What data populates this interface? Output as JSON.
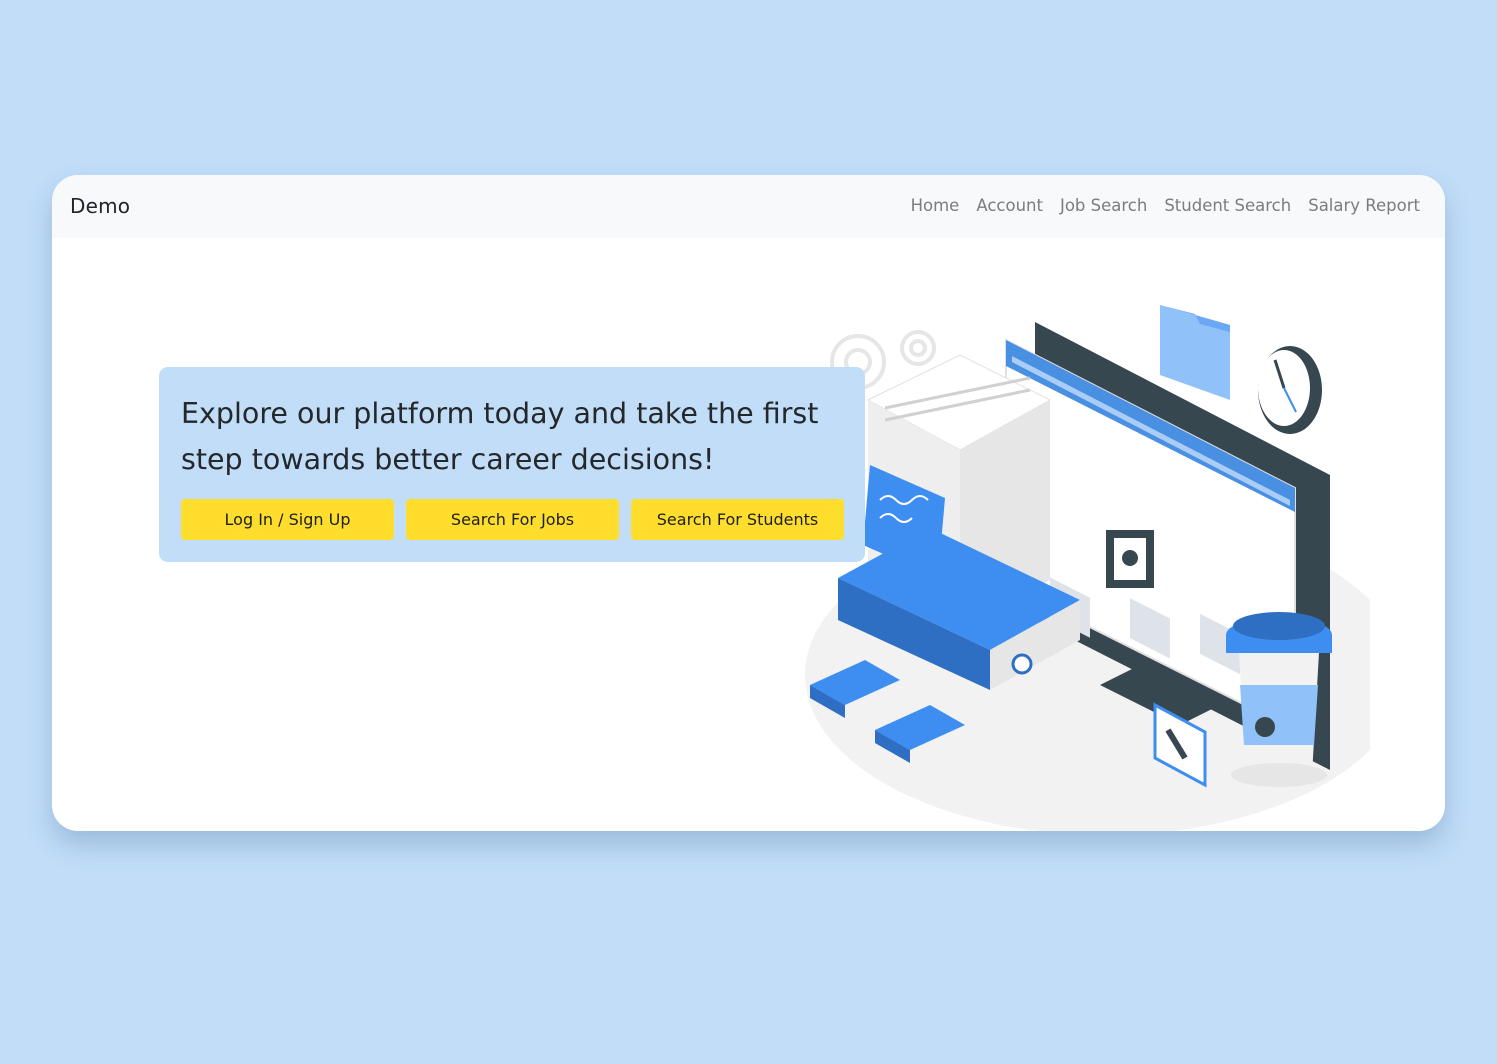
{
  "navbar": {
    "brand": "Demo",
    "links": [
      "Home",
      "Account",
      "Job Search",
      "Student Search",
      "Salary Report"
    ]
  },
  "hero": {
    "headline": "Explore our platform today and take the first step towards better career decisions!",
    "buttons": [
      "Log In / Sign Up",
      "Search For Jobs",
      "Search For Students"
    ]
  },
  "colors": {
    "page_background": "#c1ddf8",
    "hero_background": "#c1ddf8",
    "button_background": "#ffdd2d",
    "navbar_background": "#f8f9fa",
    "accent_blue": "#3d8ef0"
  },
  "illustration": {
    "icon": "career-workspace-illustration"
  }
}
